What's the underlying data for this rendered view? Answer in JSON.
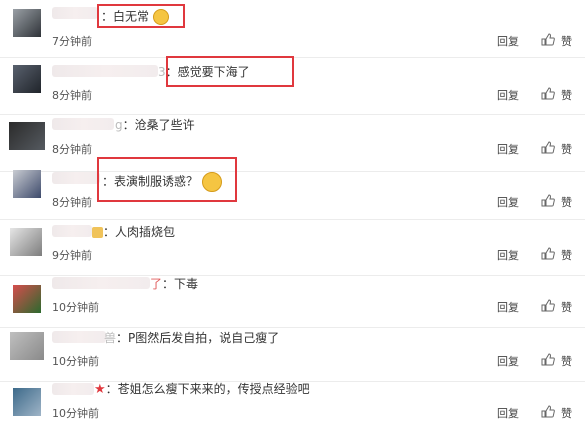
{
  "colors": {
    "highlight_box": "#e0383e",
    "border": "#ececec"
  },
  "comments": [
    {
      "text": "：白无常",
      "emoji": "face-icon",
      "time": "7分钟前",
      "reply": "回复",
      "like": "赞"
    },
    {
      "prefix": "3",
      "text": "：感觉要下海了",
      "time": "8分钟前",
      "reply": "回复",
      "like": "赞"
    },
    {
      "prefix": "g",
      "text": "：沧桑了些许",
      "time": "8分钟前",
      "reply": "回复",
      "like": "赞"
    },
    {
      "text": "：表演制服诱惑？",
      "emoji": "face-icon",
      "time": "8分钟前",
      "reply": "回复",
      "like": "赞"
    },
    {
      "text": "：人肉插烧包",
      "time": "9分钟前",
      "reply": "回复",
      "like": "赞"
    },
    {
      "prefix": "了",
      "text": "：下毒",
      "time": "10分钟前",
      "reply": "回复",
      "like": "赞"
    },
    {
      "prefix": "兽",
      "text": "：P图然后发自拍，说自己瘦了",
      "time": "10分钟前",
      "reply": "回复",
      "like": "赞"
    },
    {
      "star": "★",
      "text": "：苍姐怎么瘦下来来的，传授点经验吧",
      "time": "10分钟前",
      "reply": "回复",
      "like": "赞"
    }
  ]
}
